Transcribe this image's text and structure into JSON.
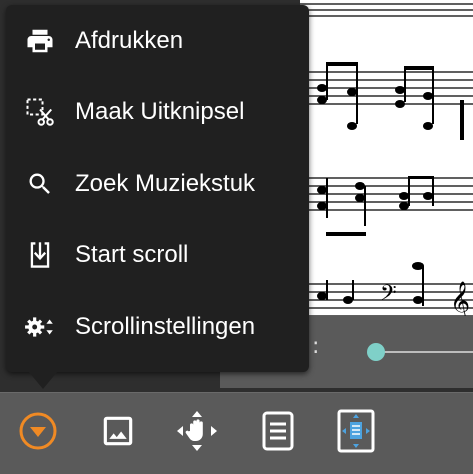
{
  "menu": {
    "items": [
      {
        "label": "Afdrukken",
        "icon": "print-icon"
      },
      {
        "label": "Maak Uitknipsel",
        "icon": "scissors-crop-icon"
      },
      {
        "label": "Zoek Muziekstuk",
        "icon": "search-icon"
      },
      {
        "label": "Start scroll",
        "icon": "scroll-down-icon"
      },
      {
        "label": "Scrollinstellingen",
        "icon": "settings-sort-icon"
      }
    ]
  },
  "scroll_panel": {
    "label_fragment": ":",
    "slider_level": 0.05
  },
  "toolbar": {
    "buttons": [
      {
        "name": "menu-toggle-icon",
        "active_color": "#f08a24"
      },
      {
        "name": "image-icon"
      },
      {
        "name": "pan-hand-icon"
      },
      {
        "name": "page-icon"
      },
      {
        "name": "fit-page-icon",
        "accent_color": "#4da3e0"
      }
    ]
  },
  "colors": {
    "menu_background": "#202020",
    "toolbar_background": "#5a5a5a",
    "accent_orange": "#f08a24",
    "slider_thumb": "#7fd0c8"
  }
}
